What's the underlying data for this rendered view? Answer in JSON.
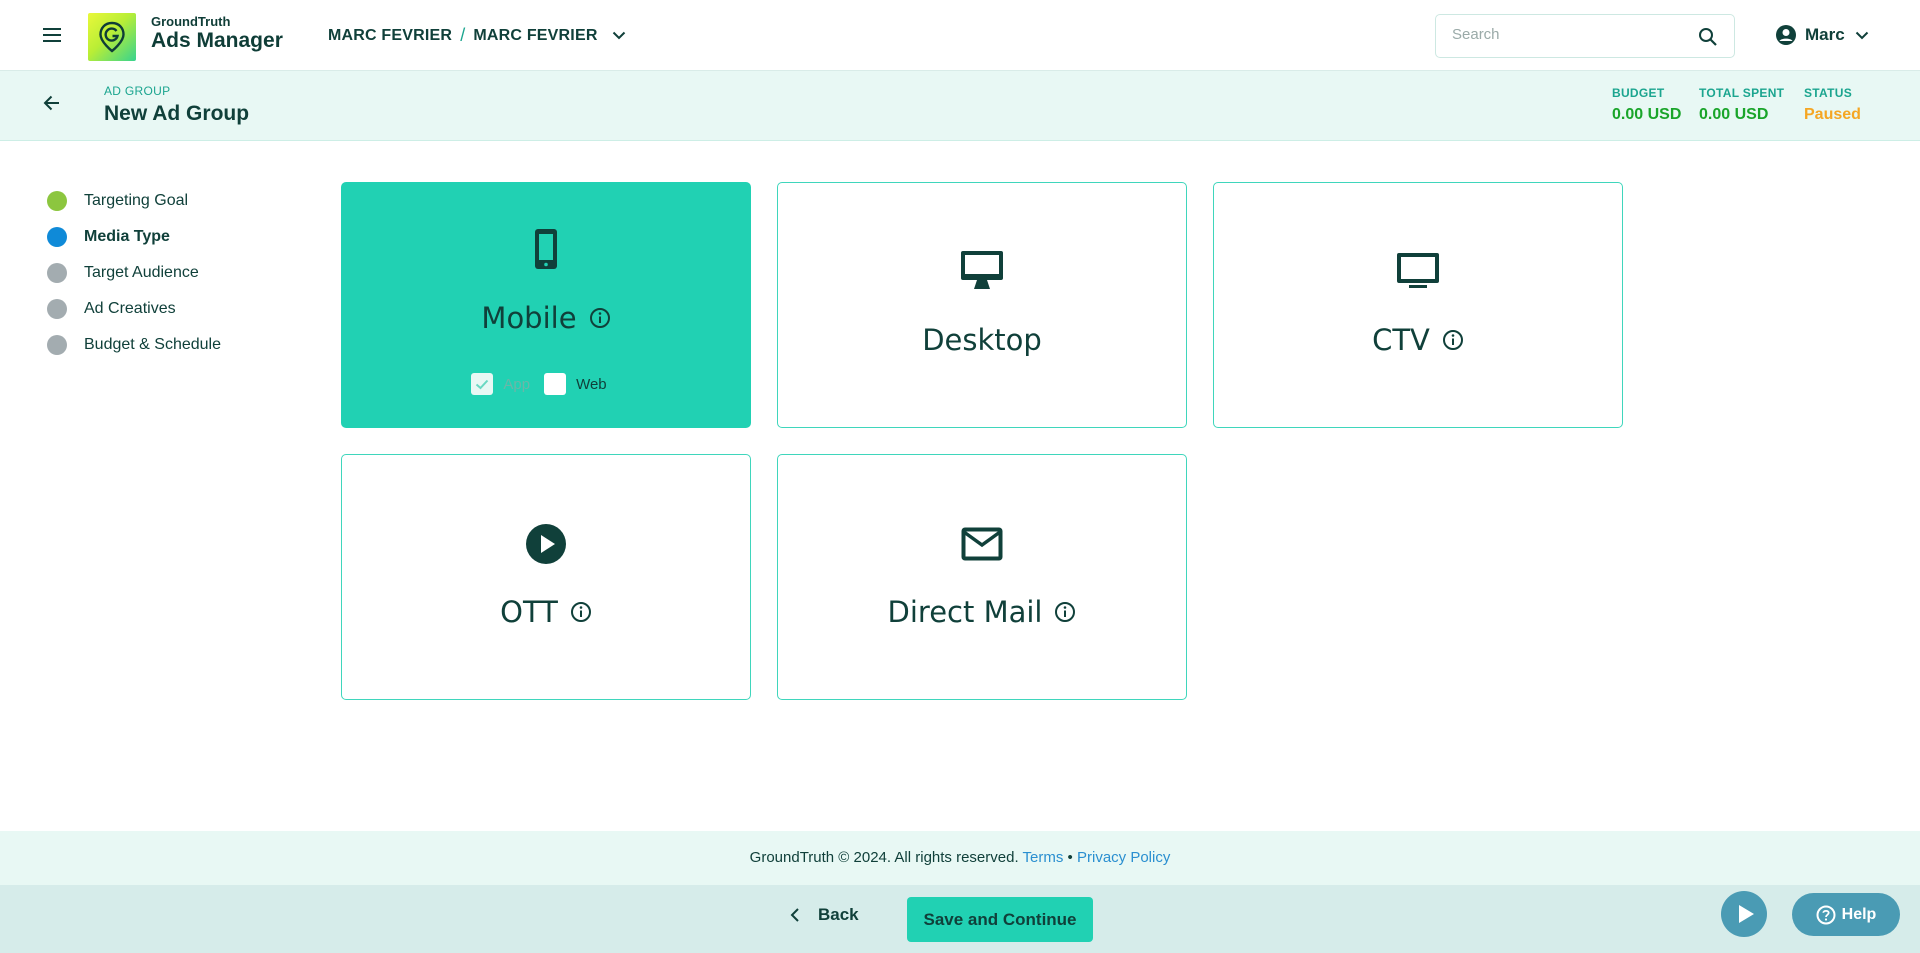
{
  "header": {
    "brand_small": "GroundTruth",
    "brand_large": "Ads Manager",
    "account_left": "MARC FEVRIER",
    "account_sep": "/",
    "account_right": "MARC FEVRIER",
    "search_placeholder": "Search",
    "user_name": "Marc"
  },
  "ad_group": {
    "label": "AD GROUP",
    "title": "New Ad Group",
    "budget_label": "BUDGET",
    "budget_value": "0.00 USD",
    "spent_label": "TOTAL SPENT",
    "spent_value": "0.00 USD",
    "status_label": "STATUS",
    "status_value": "Paused"
  },
  "steps": [
    {
      "label": "Targeting Goal",
      "color": "#8cc63f"
    },
    {
      "label": "Media Type",
      "color": "#0f8ad8"
    },
    {
      "label": "Target Audience",
      "color": "#a3acb0"
    },
    {
      "label": "Ad Creatives",
      "color": "#a3acb0"
    },
    {
      "label": "Budget & Schedule",
      "color": "#a3acb0"
    }
  ],
  "media": {
    "mobile": {
      "title": "Mobile",
      "app_label": "App",
      "web_label": "Web"
    },
    "desktop": {
      "title": "Desktop"
    },
    "ctv": {
      "title": "CTV"
    },
    "ott": {
      "title": "OTT"
    },
    "direct_mail": {
      "title": "Direct Mail"
    }
  },
  "footer": {
    "copyright": "GroundTruth © 2024. All rights reserved.",
    "terms": "Terms",
    "bullet": "•",
    "privacy": "Privacy Policy"
  },
  "actions": {
    "back": "Back",
    "save": "Save and Continue",
    "help": "Help"
  },
  "colors": {
    "accent": "#21d1b3",
    "dark": "#10403a",
    "status_paused": "#f5a623",
    "money": "#1aa52a"
  }
}
